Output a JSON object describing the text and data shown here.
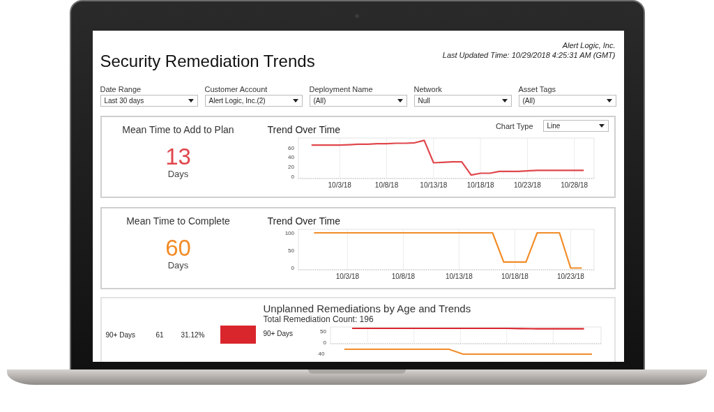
{
  "header": {
    "title": "Security Remediation Trends",
    "company": "Alert Logic, Inc.",
    "last_updated": "Last Updated Time: 10/29/2018 4:25:31 AM (GMT)"
  },
  "filters": [
    {
      "label": "Date Range",
      "value": "Last 30 days"
    },
    {
      "label": "Customer Account",
      "value": "Alert Logic, Inc.(2)"
    },
    {
      "label": "Deployment Name",
      "value": "(All)"
    },
    {
      "label": "Network",
      "value": "Null"
    },
    {
      "label": "Asset Tags",
      "value": "(All)"
    }
  ],
  "metrics": [
    {
      "title": "Mean Time to Add to Plan",
      "value": "13",
      "unit": "Days",
      "color": "#e0474c",
      "chart_title": "Trend Over Time",
      "chart_type": {
        "label": "Chart Type",
        "value": "Line"
      },
      "chart_data": {
        "type": "line",
        "grid": true,
        "categories": [
          null,
          null,
          null,
          "10/3/18",
          null,
          null,
          null,
          null,
          "10/8/18",
          null,
          null,
          null,
          null,
          "10/13/18",
          null,
          null,
          null,
          null,
          "10/18/18",
          null,
          null,
          null,
          null,
          "10/23/18",
          null,
          null,
          null,
          null,
          "10/28/18",
          null
        ],
        "series": [
          {
            "color": "#e0474c",
            "values": [
              65,
              65,
              65,
              65,
              66,
              67,
              67,
              68,
              68,
              69,
              69,
              70,
              75,
              28,
              29,
              30,
              30,
              2,
              6,
              6,
              10,
              10,
              10,
              11,
              12,
              12,
              12,
              12,
              12,
              12
            ]
          }
        ],
        "ylim": [
          -5,
          80
        ],
        "yticks": [
          0,
          20,
          40,
          60
        ]
      }
    },
    {
      "title": "Mean Time to Complete",
      "value": "60",
      "unit": "Days",
      "color": "#f28c28",
      "chart_title": "Trend Over Time",
      "chart_data": {
        "type": "line",
        "grid": true,
        "categories": [
          null,
          null,
          null,
          "10/3/18",
          null,
          null,
          null,
          null,
          "10/8/18",
          null,
          null,
          null,
          null,
          "10/13/18",
          null,
          null,
          null,
          null,
          "10/18/18",
          null,
          null,
          null,
          null,
          "10/23/18",
          null
        ],
        "series": [
          {
            "color": "#f28c28",
            "values": [
              100,
              100,
              100,
              100,
              100,
              100,
              100,
              100,
              100,
              100,
              100,
              100,
              100,
              100,
              100,
              100,
              100,
              17,
              17,
              17,
              100,
              100,
              100,
              0,
              0
            ]
          }
        ],
        "ylim": [
          -5,
          110
        ],
        "yticks": [
          0,
          50,
          100
        ]
      }
    }
  ],
  "age_panel": {
    "title": "Unplanned Remediations by Age and Trends",
    "total_label": "Total Remediation Count:",
    "total": "196",
    "rows": [
      {
        "label": "90+ Days",
        "count": "61",
        "percent": "31.12%",
        "color": "#d9262c",
        "level": 0.3112
      }
    ],
    "trends": [
      {
        "label": "90+ Days",
        "chart_data": {
          "type": "line",
          "grid": true,
          "categories": [
            null,
            null,
            null,
            null,
            null,
            null,
            null,
            null,
            null,
            null,
            null,
            null,
            null,
            null,
            null,
            null
          ],
          "series": [
            {
              "color": "#d9262c",
              "values": [
                62,
                62,
                62,
                62,
                62,
                62,
                62,
                62,
                62,
                62,
                62,
                61,
                60,
                60,
                60,
                60
              ]
            }
          ],
          "ylim": [
            -5,
            68
          ],
          "yticks": [
            0,
            50
          ]
        }
      },
      {
        "tick_label": "40",
        "color": "#f28c28"
      }
    ]
  }
}
